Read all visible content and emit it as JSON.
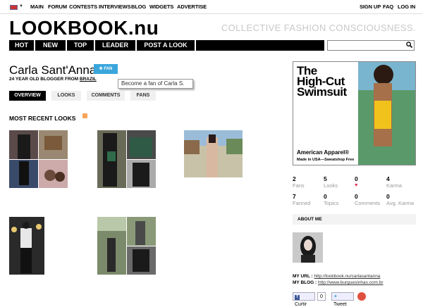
{
  "topbar": {
    "nav": [
      "MAIN",
      "FORUM",
      "CONTESTS",
      "INTERVIEWS",
      "BLOG",
      "WIDGETS",
      "ADVERTISE"
    ],
    "right": [
      "SIGN UP",
      "FAQ",
      "LOG IN"
    ]
  },
  "header": {
    "logo": "LOOKBOOK.nu",
    "tagline": "COLLECTIVE FASHION CONSCIOUSNESS."
  },
  "mainnav": [
    "HOT",
    "NEW",
    "TOP",
    "LEADER",
    "POST A LOOK"
  ],
  "profile": {
    "name": "Carla Sant'Anna",
    "fan_button": "✚ FAN",
    "subline_prefix": "24 YEAR OLD BLOGGER FROM ",
    "country": "BRAZIL",
    "tooltip": "Become a fan of Carla S."
  },
  "tabs": [
    "OVERVIEW",
    "LOOKS",
    "COMMENTS",
    "FANS"
  ],
  "section_title": "MOST RECENT LOOKS",
  "ad": {
    "headline_1": "The",
    "headline_2": "High-Cut",
    "headline_3": "Swimsuit",
    "brand": "American Apparel®",
    "sub": "Made in USA—Sweatshop Free"
  },
  "stats": [
    {
      "value": "2",
      "label": "Fans"
    },
    {
      "value": "5",
      "label": "Looks"
    },
    {
      "value": "0",
      "label": "♥"
    },
    {
      "value": "4",
      "label": "Karma"
    },
    {
      "value": "7",
      "label": "Fanned"
    },
    {
      "value": "0",
      "label": "Topics"
    },
    {
      "value": "0",
      "label": "Comments"
    },
    {
      "value": "0",
      "label": "Avg. Karma"
    }
  ],
  "about_title": "ABOUT ME",
  "links": {
    "url_label": "MY URL :",
    "url": "http://lookbook.nu/carlasantanna",
    "blog_label": "MY BLOG :",
    "blog": "http://www.burguesinhas.com.br"
  },
  "share": {
    "fb": "Curtir",
    "fb_count": "0",
    "tweet": "Tweet"
  },
  "colors": {
    "fan_button": "#3aa6dc",
    "nav_bg": "#000000",
    "heart": "#e0305a"
  }
}
